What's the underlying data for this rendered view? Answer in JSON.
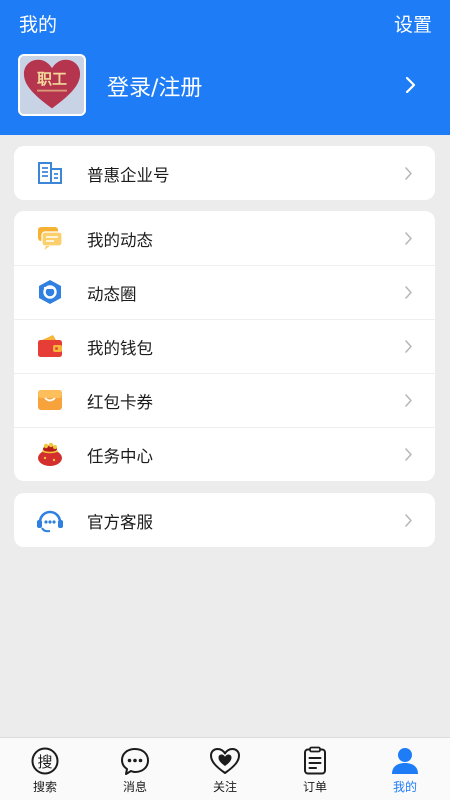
{
  "header": {
    "title": "我的",
    "settings_label": "设置",
    "bg_color": "#1e7cf7"
  },
  "profile": {
    "avatar_text": "职工",
    "login_label": "登录/注册"
  },
  "cards": [
    {
      "items": [
        {
          "label": "普惠企业号",
          "icon": "building-icon"
        }
      ]
    },
    {
      "items": [
        {
          "label": "我的动态",
          "icon": "message-bubble-icon"
        },
        {
          "label": "动态圈",
          "icon": "aperture-icon"
        },
        {
          "label": "我的钱包",
          "icon": "wallet-icon"
        },
        {
          "label": "红包卡券",
          "icon": "coupon-icon"
        },
        {
          "label": "任务中心",
          "icon": "money-bag-icon"
        }
      ]
    },
    {
      "items": [
        {
          "label": "官方客服",
          "icon": "headset-icon"
        }
      ]
    }
  ],
  "tabbar": {
    "items": [
      {
        "label": "搜索",
        "icon": "search-icon",
        "active": false
      },
      {
        "label": "消息",
        "icon": "chat-icon",
        "active": false
      },
      {
        "label": "关注",
        "icon": "heart-icon",
        "active": false
      },
      {
        "label": "订单",
        "icon": "order-icon",
        "active": false
      },
      {
        "label": "我的",
        "icon": "user-icon",
        "active": true
      }
    ],
    "active_color": "#1e7cf7"
  }
}
